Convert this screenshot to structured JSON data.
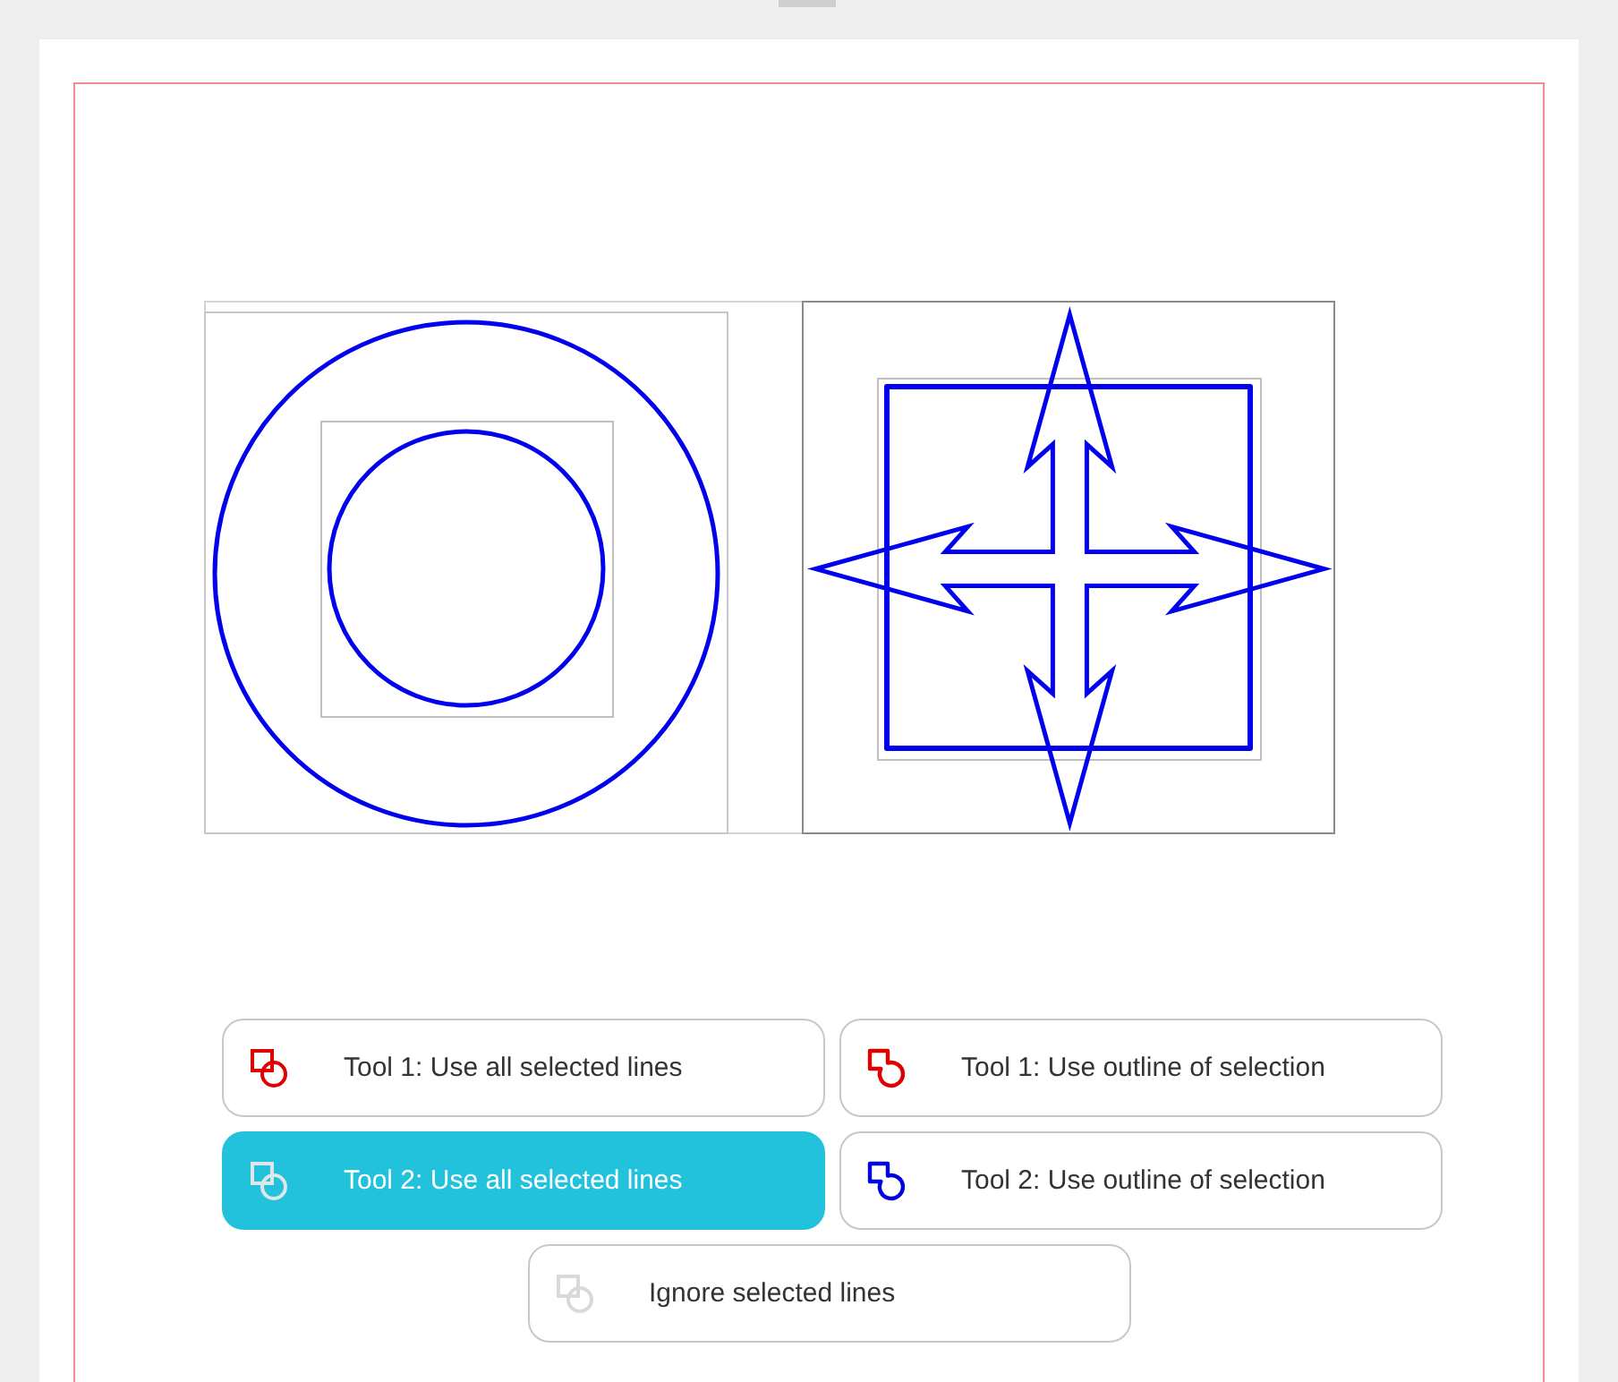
{
  "buttons": [
    {
      "label": "Tool 1: Use all selected lines",
      "kind": "overlap",
      "color": "#e00000",
      "selected": false
    },
    {
      "label": "Tool 1: Use outline of selection",
      "kind": "outline",
      "color": "#e00000",
      "selected": false
    },
    {
      "label": "Tool 2: Use all selected lines",
      "kind": "overlap",
      "color": "#dde6e8",
      "selected": true
    },
    {
      "label": "Tool 2: Use outline of selection",
      "kind": "outline",
      "color": "#0000e0",
      "selected": false
    },
    {
      "label": "Ignore selected lines",
      "kind": "overlap",
      "color": "#d9d9d9",
      "selected": false
    }
  ]
}
